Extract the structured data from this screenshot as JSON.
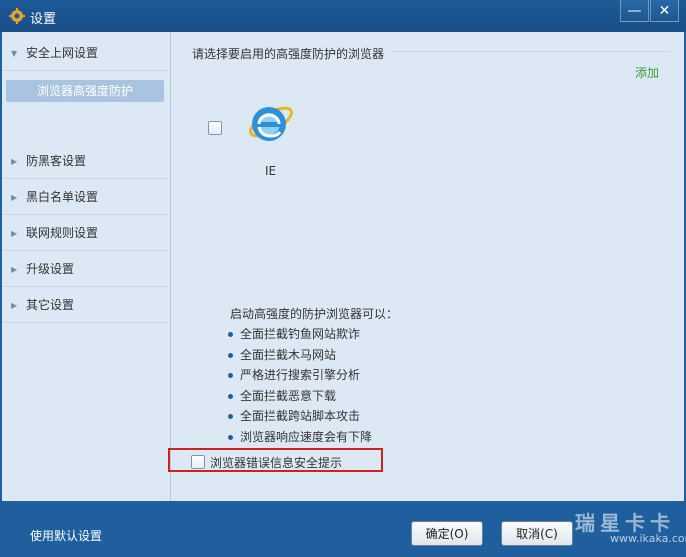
{
  "window": {
    "title": "设置",
    "minimize_glyph": "—",
    "close_glyph": "✕"
  },
  "sidebar": {
    "items": [
      {
        "label": "安全上网设置",
        "arrow": "expanded"
      },
      {
        "label": "防黑客设置",
        "arrow": "collapsed"
      },
      {
        "label": "黑白名单设置",
        "arrow": "collapsed"
      },
      {
        "label": "联网规则设置",
        "arrow": "collapsed"
      },
      {
        "label": "升级设置",
        "arrow": "collapsed"
      },
      {
        "label": "其它设置",
        "arrow": "collapsed"
      }
    ],
    "selected_sub": "浏览器高强度防护"
  },
  "main": {
    "title": "请选择要启用的高强度防护的浏览器",
    "add_label": "添加",
    "browsers": [
      {
        "name": "IE",
        "checked": false,
        "icon": "ie-icon"
      }
    ],
    "info_header": "启动高强度的防护浏览器可以：",
    "info_items": [
      "全面拦截钓鱼网站欺诈",
      "全面拦截木马网站",
      "严格进行搜索引擎分析",
      "全面拦截恶意下载",
      "全面拦截跨站脚本攻击",
      "浏览器响应速度会有下降"
    ],
    "alert_option": {
      "label": "浏览器错误信息安全提示",
      "checked": false
    }
  },
  "footer": {
    "default_settings": "使用默认设置",
    "ok": "确定(O)",
    "cancel": "取消(C)",
    "watermark_cn": "瑞星卡卡",
    "watermark_url": "www.ikaka.com"
  },
  "colors": {
    "titlebar": "#1d5a98",
    "content_bg": "#dce9f5",
    "selected_sub": "#a9c4e0",
    "add_link": "#3a9a3a",
    "highlight_border": "#d02020"
  }
}
